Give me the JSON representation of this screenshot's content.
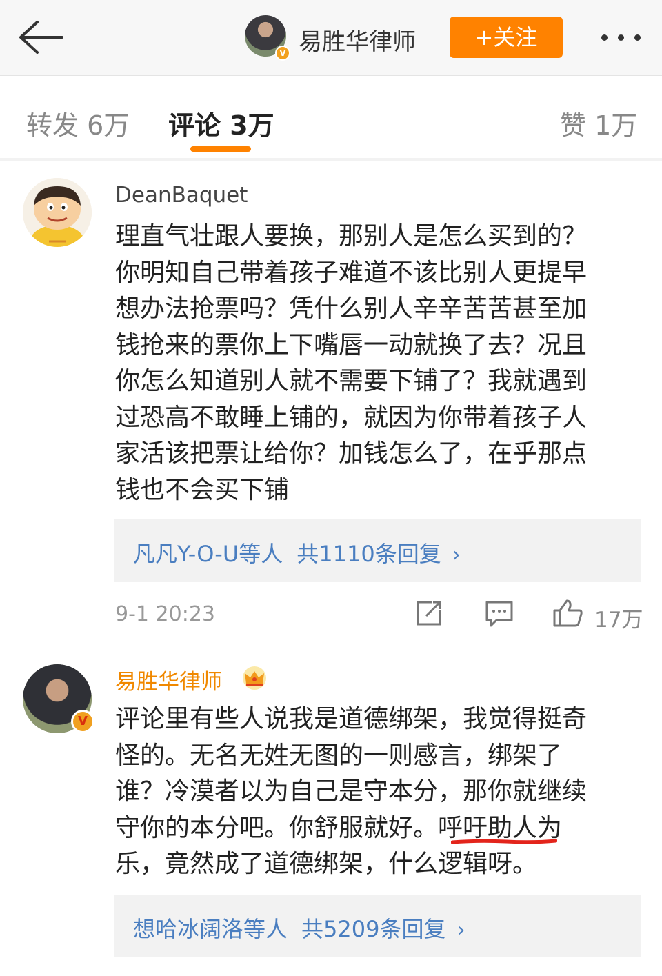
{
  "header": {
    "back_icon": "back-arrow-icon",
    "account_name": "易胜华律师",
    "follow_label": "+关注",
    "more_icon": "more-dots-icon",
    "accent_color": "#ff8200"
  },
  "tabs": [
    {
      "label": "转发 6万",
      "active": false
    },
    {
      "label": "评论 3万",
      "active": true
    },
    {
      "label": "赞 1万",
      "active": false
    }
  ],
  "comments": [
    {
      "username": "DeanBaquet",
      "avatar_icon": "cartoon-avatar-icon",
      "lines": [
        "理直气壮跟人要换，那别人是怎么买到的？",
        "你明知自己带着孩子难道不该比别人更提早",
        "想办法抢票吗？凭什么别人辛辛苦苦甚至加",
        "钱抢来的票你上下嘴唇一动就换了去？况且",
        "你怎么知道别人就不需要下铺了？我就遇到",
        "过恐高不敢睡上铺的，就因为你带着孩子人",
        "家活该把票让给你？加钱怎么了，在乎那点",
        "钱也不会买下铺"
      ],
      "reply_names": "凡凡Y-O-U等人",
      "reply_count": "共1110条回复",
      "time": "9-1 20:23",
      "likes": "17万"
    },
    {
      "username": "易胜华律师",
      "badge_icon": "crown-icon",
      "avatar_icon": "verified-v-icon",
      "lines": [
        "评论里有些人说我是道德绑架，我觉得挺奇",
        "怪的。无名无姓无图的一则感言，绑架了",
        "谁？冷漠者以为自己是守本分，那你就继续",
        "守你的本分吧。你舒服就好。呼吁助人为",
        "乐，竟然成了道德绑架，什么逻辑呀。"
      ],
      "reply_names": "想哈冰阔洛等人",
      "reply_count": "共5209条回复"
    }
  ]
}
